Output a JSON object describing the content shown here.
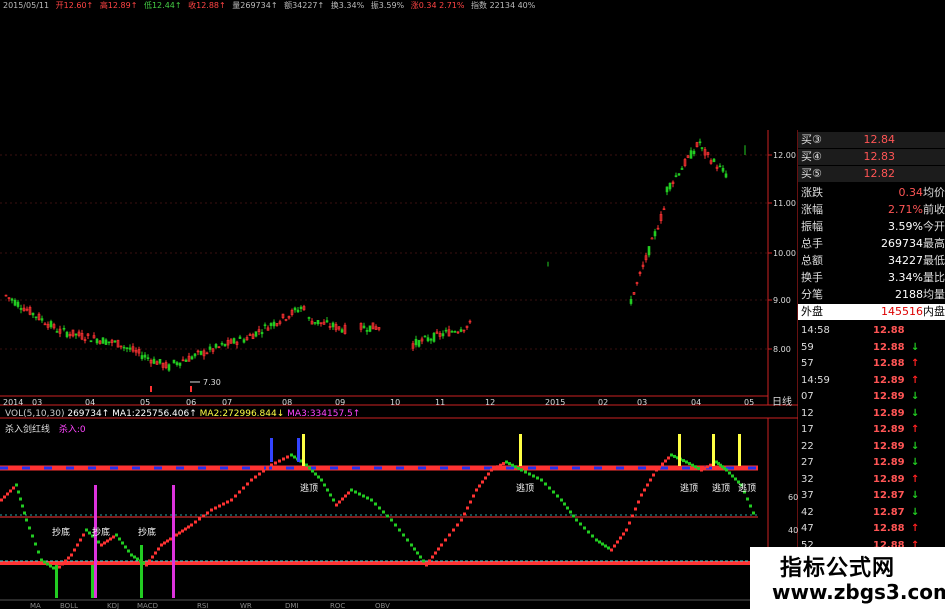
{
  "top_bar": {
    "date": "2015/05/11",
    "open": "开12.60↑",
    "high": "高12.89↑",
    "low": "低12.44↑",
    "close": "收12.88↑",
    "volume": "量269734↑",
    "amount": "额34227↑",
    "turnover": "换3.34%",
    "amplitude": "振3.59%",
    "change": "涨0.34 2.71%",
    "extra": "指数 22134 40%"
  },
  "price_axis": {
    "ticks": [
      "12.00",
      "11.00",
      "10.00",
      "9.00",
      "8.00"
    ],
    "low_annotation": "7.30"
  },
  "time_axis": {
    "labels": [
      "2014",
      "03",
      "04",
      "05",
      "06",
      "07",
      "08",
      "09",
      "10",
      "11",
      "12",
      "2015",
      "02",
      "03",
      "04",
      "05"
    ],
    "period": "日线"
  },
  "volume_indicator": {
    "title": "VOL(5,10,30)",
    "vol": "269734↑",
    "ma1": "MA1:225756.406↑",
    "ma2": "MA2:272996.844↓",
    "ma3": "MA3:334157.5↑"
  },
  "custom_indicator": {
    "name": "杀入剑红线",
    "value": "杀入:0",
    "signal_top": "逃顶",
    "signal_bottom": "抄底",
    "scale": [
      "60",
      "40"
    ]
  },
  "bottom_tabs": [
    "MA",
    "BOLL",
    "KDJ",
    "MACD",
    "RSI",
    "WR",
    "DMI",
    "ROC",
    "OBV"
  ],
  "quote_panel": {
    "buy_levels": [
      {
        "label": "买③",
        "price": "12.84"
      },
      {
        "label": "买④",
        "price": "12.83"
      },
      {
        "label": "买⑤",
        "price": "12.82"
      }
    ],
    "stats": [
      {
        "label": "涨跌",
        "value": "0.34",
        "label2": "均价"
      },
      {
        "label": "涨幅",
        "value": "2.71%",
        "label2": "前收"
      },
      {
        "label": "振幅",
        "value": "3.59%",
        "label2": "今开"
      },
      {
        "label": "总手",
        "value": "269734",
        "label2": "最高"
      },
      {
        "label": "总额",
        "value": "34227",
        "label2": "最低"
      },
      {
        "label": "换手",
        "value": "3.34%",
        "label2": "量比"
      },
      {
        "label": "分笔",
        "value": "2188",
        "label2": "均量"
      },
      {
        "label": "外盘",
        "value": "145516",
        "label2": "内盘"
      }
    ],
    "ticks": [
      {
        "time": "14:58",
        "price": "12.88",
        "dir": ""
      },
      {
        "time": "59",
        "price": "12.88",
        "dir": "↓"
      },
      {
        "time": "57",
        "price": "12.88",
        "dir": "↑"
      },
      {
        "time": "14:59",
        "price": "12.89",
        "dir": "↑"
      },
      {
        "time": "07",
        "price": "12.89",
        "dir": "↓"
      },
      {
        "time": "12",
        "price": "12.89",
        "dir": "↓"
      },
      {
        "time": "17",
        "price": "12.89",
        "dir": "↑"
      },
      {
        "time": "22",
        "price": "12.89",
        "dir": "↓"
      },
      {
        "time": "27",
        "price": "12.89",
        "dir": "↓"
      },
      {
        "time": "32",
        "price": "12.89",
        "dir": "↑"
      },
      {
        "time": "37",
        "price": "12.87",
        "dir": "↓"
      },
      {
        "time": "42",
        "price": "12.87",
        "dir": "↓"
      },
      {
        "time": "47",
        "price": "12.88",
        "dir": "↑"
      },
      {
        "time": "52",
        "price": "12.88",
        "dir": "↑"
      }
    ]
  },
  "watermark": {
    "title": "指标公式网",
    "url": "www.zbgs3.com"
  },
  "colors": {
    "up": "#ff3333",
    "down": "#22cc22",
    "axis": "#cc2222",
    "signal": "#ffff44"
  }
}
